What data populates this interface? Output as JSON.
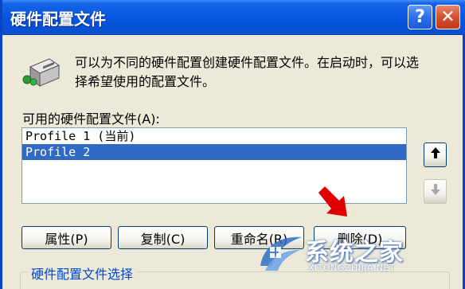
{
  "window": {
    "title": "硬件配置文件",
    "help_glyph": "?",
    "close_glyph": "✕"
  },
  "description": "可以为不同的硬件配置创建硬件配置文件。在启动时，可以选择希望使用的配置文件。",
  "list": {
    "label": "可用的硬件配置文件(A):",
    "items": [
      {
        "label": "Profile 1 (当前)",
        "selected": false
      },
      {
        "label": "Profile 2",
        "selected": true
      }
    ]
  },
  "side_buttons": {
    "up_glyph": "🡑",
    "down_glyph": "🡓"
  },
  "actions": {
    "properties": "属性(P)",
    "copy": "复制(C)",
    "rename": "重命名(R)",
    "delete": "删除(D)"
  },
  "selection_group_label": "硬件配置文件选择",
  "watermark": {
    "name": "系统之家",
    "url": "XITONGZHIJIA.NET"
  },
  "colors": {
    "title_bar": "#0a58e0",
    "selection": "#316ac5",
    "annotation_arrow": "#e00000",
    "group_label": "#0046d5"
  }
}
